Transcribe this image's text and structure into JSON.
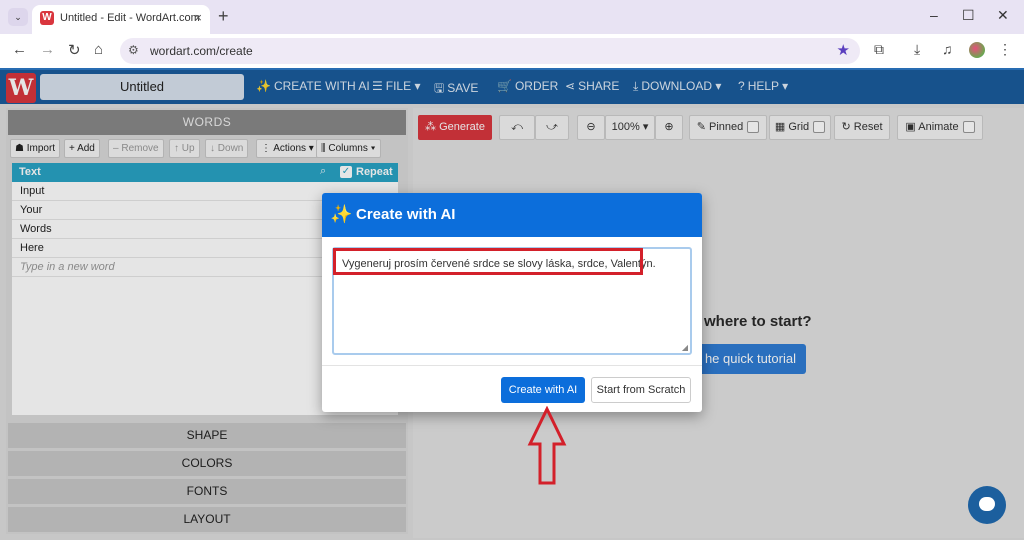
{
  "browser": {
    "tab_title": "Untitled - Edit - WordArt.com",
    "tab_favicon": "W",
    "tab_close": "×",
    "new_tab": "+",
    "tab_dropdown": "⌄",
    "window_controls": {
      "minimize": "–",
      "maximize": "☐",
      "close": "✕"
    },
    "nav": {
      "back": "←",
      "forward": "→",
      "reload": "↻",
      "home": "⌂"
    },
    "url": "wordart.com/create",
    "icons": [
      "tune-icon",
      "star-icon",
      "extensions-icon",
      "download-icon",
      "media-icon",
      "profile-avatar",
      "more-icon"
    ]
  },
  "header": {
    "logo": "W",
    "doc_title": "Untitled",
    "menu": [
      {
        "icon": "✨",
        "label": "CREATE WITH AI"
      },
      {
        "icon": "☰",
        "label": "FILE ▾"
      },
      {
        "icon": "🖫",
        "label": "SAVE"
      },
      {
        "icon": "🛒",
        "label": "ORDER"
      },
      {
        "icon": "⋖",
        "label": "SHARE"
      },
      {
        "icon": "⤓",
        "label": "DOWNLOAD ▾"
      },
      {
        "icon": "?",
        "label": "HELP ▾"
      }
    ]
  },
  "words_panel": {
    "title": "WORDS",
    "toolbar": [
      {
        "icon": "☗",
        "label": "Import",
        "disabled": false
      },
      {
        "icon": "+",
        "label": "Add",
        "disabled": false
      },
      {
        "icon": "–",
        "label": "Remove",
        "disabled": true
      },
      {
        "icon": "↑",
        "label": "Up",
        "disabled": true
      },
      {
        "icon": "↓",
        "label": "Down",
        "disabled": true
      },
      {
        "icon": "⋮",
        "label": "Actions ▾",
        "disabled": false
      },
      {
        "icon": "⫼",
        "label": "Columns ▾",
        "disabled": false
      }
    ],
    "columns": {
      "text": "Text",
      "repeat": "Repeat"
    },
    "words": [
      "Input",
      "Your",
      "Words",
      "Here"
    ],
    "new_word_placeholder": "Type in a new word"
  },
  "accordion": [
    "SHAPE",
    "COLORS",
    "FONTS",
    "LAYOUT"
  ],
  "canvas_toolbar": {
    "generate": "Generate",
    "undo": "⤺",
    "redo": "⤻",
    "zoom_out": "⊖",
    "zoom_level": "100% ▾",
    "zoom_in": "⊕",
    "pinned": "Pinned",
    "grid": "Grid",
    "reset": "Reset",
    "animate": "Animate"
  },
  "background": {
    "heading_fragment": "where to start?",
    "tutorial_fragment": "he quick tutorial"
  },
  "modal": {
    "title": "Create with AI",
    "prompt": "Vygeneruj prosím červené srdce se slovy láska, srdce, Valentýn.",
    "primary_button": "Create with AI",
    "secondary_button": "Start from Scratch"
  },
  "colors": {
    "header_blue": "#1a5c9c",
    "modal_blue": "#0c6edb",
    "accent_red": "#d9363e",
    "grid_header": "#29a3c4",
    "annotation_red": "#d3202a"
  }
}
